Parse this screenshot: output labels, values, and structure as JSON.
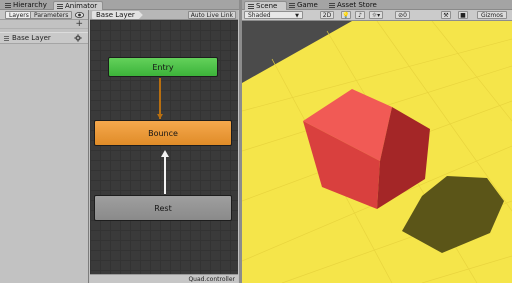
{
  "left_tabs": {
    "hierarchy": "Hierarchy",
    "animator": "Animator"
  },
  "animator": {
    "layers_tab": "Layers",
    "parameters_tab": "Parameters",
    "add": "+",
    "layer": {
      "name": "Base Layer"
    },
    "breadcrumb": "Base Layer",
    "auto_live_link": "Auto Live Link",
    "states": {
      "entry": "Entry",
      "bounce": "Bounce",
      "rest": "Rest"
    },
    "controller_file": "Quad.controller"
  },
  "right_tabs": {
    "scene": "Scene",
    "game": "Game",
    "asset_store": "Asset Store"
  },
  "scene_toolbar": {
    "shading_mode": "Shaded",
    "mode_2d": "2D",
    "effects_count": "0",
    "gizmos": "Gizmos"
  },
  "colors": {
    "ground": "#f5e54a",
    "cube_front": "#e1413f",
    "cube_top": "#f15a55",
    "cube_side": "#a9282a",
    "shadow": "#5b5518",
    "sky": "#4e4e4e",
    "state_entry": "#4fc24a",
    "state_bounce": "#ec9a38",
    "state_rest": "#969696"
  }
}
